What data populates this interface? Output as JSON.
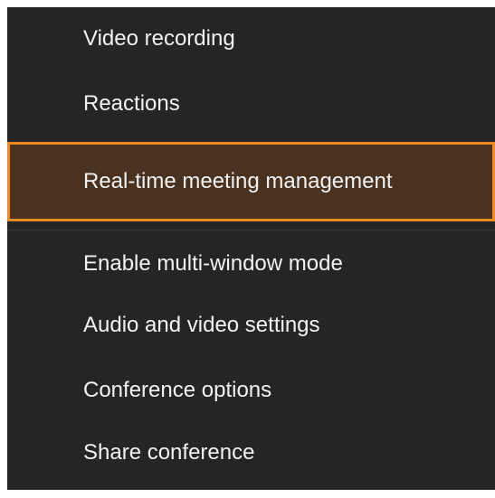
{
  "menu": {
    "items": [
      {
        "label": "Video recording"
      },
      {
        "label": "Reactions"
      },
      {
        "label": "Real-time meeting management",
        "selected": true
      },
      {
        "label": "Enable multi-window mode"
      },
      {
        "label": "Audio and video settings"
      },
      {
        "label": "Conference options"
      },
      {
        "label": "Share conference"
      }
    ]
  },
  "colors": {
    "menu_background": "#252525",
    "text": "#f2f2f2",
    "selected_background": "#4a3220",
    "selected_border": "#f08a24",
    "page_background": "#ffffff"
  }
}
